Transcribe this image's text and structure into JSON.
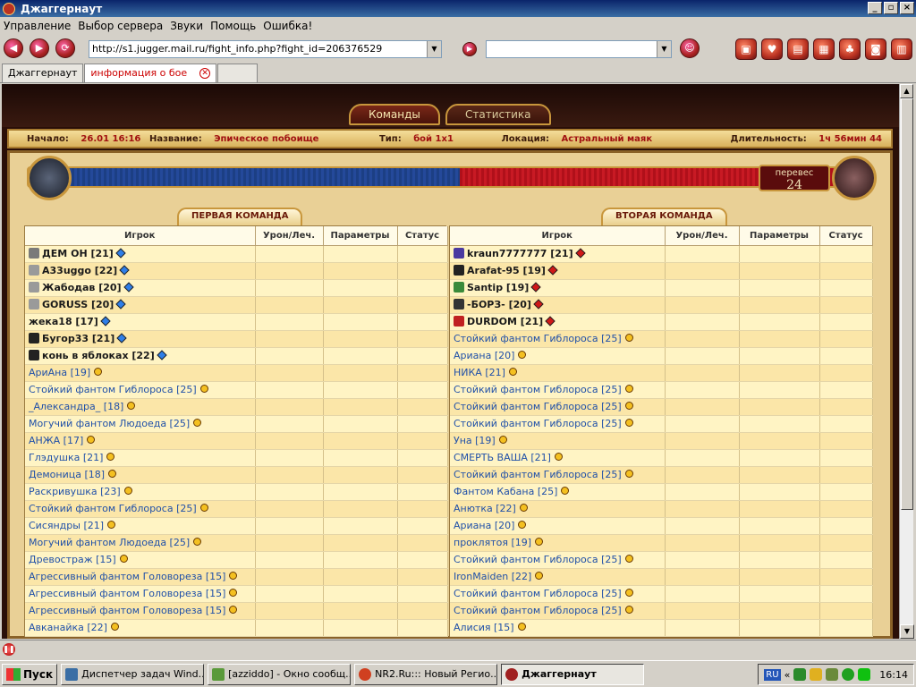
{
  "window": {
    "title": "Джаггернаут"
  },
  "menu": [
    "Управление",
    "Выбор сервера",
    "Звуки",
    "Помощь",
    "Ошибка!"
  ],
  "address": {
    "url": "http://s1.jugger.mail.ru/fight_info.php?fight_id=206376529"
  },
  "tabs": [
    {
      "label": "Джаггернаут"
    },
    {
      "label": "информация о бое"
    }
  ],
  "game_tabs": {
    "teams": "Команды",
    "stats": "Статистика"
  },
  "info": {
    "start_label": "Начало:",
    "start_value": "26.01 16:16",
    "name_label": "Название:",
    "name_value": "Эпическое побоище",
    "type_label": "Тип:",
    "type_value": "бой 1x1",
    "location_label": "Локация:",
    "location_value": "Астральный маяк",
    "duration_label": "Длительность:",
    "duration_value": "1ч 56мин 44"
  },
  "advantage": {
    "label": "перевес",
    "value": "24",
    "blue_fraction": 0.52
  },
  "team1": {
    "title": "ПЕРВАЯ КОМАНДА",
    "columns": [
      "Игрок",
      "Урон/Леч.",
      "Параметры",
      "Статус"
    ],
    "rows": [
      {
        "name": "ДЕМ ОН [21]",
        "kind": "p",
        "gem": "b",
        "icon": "#7a7a7a"
      },
      {
        "name": "A33uggo [22]",
        "kind": "p",
        "gem": "b",
        "icon": "#9a9a9a"
      },
      {
        "name": "Жабодав [20]",
        "kind": "p",
        "gem": "b",
        "icon": "#9a9a9a"
      },
      {
        "name": "GORUSS [20]",
        "kind": "p",
        "gem": "b",
        "icon": "#9a9a9a"
      },
      {
        "name": "жека18 [17]",
        "kind": "p",
        "gem": "b",
        "icon": ""
      },
      {
        "name": "Бугор33 [21]",
        "kind": "p",
        "gem": "b",
        "icon": "#222222"
      },
      {
        "name": "конь в яблоках [22]",
        "kind": "p",
        "gem": "b",
        "icon": "#222222"
      },
      {
        "name": "АриАна  [19]",
        "kind": "m",
        "gem": "y",
        "icon": ""
      },
      {
        "name": "Стойкий фантом Гиблороса [25]",
        "kind": "m",
        "gem": "y",
        "icon": ""
      },
      {
        "name": "_Александра_ [18]",
        "kind": "m",
        "gem": "y",
        "icon": ""
      },
      {
        "name": "Могучий фантом Людоеда [25]",
        "kind": "m",
        "gem": "y",
        "icon": ""
      },
      {
        "name": "АНЖА [17]",
        "kind": "m",
        "gem": "y",
        "icon": ""
      },
      {
        "name": "Глэдушка [21]",
        "kind": "m",
        "gem": "y",
        "icon": ""
      },
      {
        "name": "Демоница [18]",
        "kind": "m",
        "gem": "y",
        "icon": ""
      },
      {
        "name": "Раскривушка [23]",
        "kind": "m",
        "gem": "y",
        "icon": ""
      },
      {
        "name": "Стойкий фантом Гиблороса [25]",
        "kind": "m",
        "gem": "y",
        "icon": ""
      },
      {
        "name": "Сисяндры [21]",
        "kind": "m",
        "gem": "y",
        "icon": ""
      },
      {
        "name": "Могучий фантом Людоеда [25]",
        "kind": "m",
        "gem": "y",
        "icon": ""
      },
      {
        "name": "Древостраж [15]",
        "kind": "m",
        "gem": "y",
        "icon": ""
      },
      {
        "name": "Агрессивный фантом Головореза [15]",
        "kind": "m",
        "gem": "y",
        "icon": ""
      },
      {
        "name": "Агрессивный фантом Головореза [15]",
        "kind": "m",
        "gem": "y",
        "icon": ""
      },
      {
        "name": "Агрессивный фантом Головореза [15]",
        "kind": "m",
        "gem": "y",
        "icon": ""
      },
      {
        "name": "Авканайка [22]",
        "kind": "m",
        "gem": "y",
        "icon": ""
      }
    ]
  },
  "team2": {
    "title": "ВТОРАЯ КОМАНДА",
    "columns": [
      "Игрок",
      "Урон/Леч.",
      "Параметры",
      "Статус"
    ],
    "rows": [
      {
        "name": "kraun7777777 [21]",
        "kind": "p",
        "gem": "r",
        "icon": "#4a3aa0"
      },
      {
        "name": "Arafat-95 [19]",
        "kind": "p",
        "gem": "r",
        "icon": "#222222"
      },
      {
        "name": "Santip [19]",
        "kind": "p",
        "gem": "r",
        "icon": "#3a8a3a"
      },
      {
        "name": "-БОРЗ- [20]",
        "kind": "p",
        "gem": "r",
        "icon": "#333333"
      },
      {
        "name": "DURDOM [21]",
        "kind": "p",
        "gem": "r",
        "icon": "#c02020"
      },
      {
        "name": "Стойкий фантом Гиблороса [25]",
        "kind": "m",
        "gem": "y",
        "icon": ""
      },
      {
        "name": "Ариана [20]",
        "kind": "m",
        "gem": "y",
        "icon": ""
      },
      {
        "name": "НИКА [21]",
        "kind": "m",
        "gem": "y",
        "icon": ""
      },
      {
        "name": "Стойкий фантом Гиблороса [25]",
        "kind": "m",
        "gem": "y",
        "icon": ""
      },
      {
        "name": "Стойкий фантом Гиблороса [25]",
        "kind": "m",
        "gem": "y",
        "icon": ""
      },
      {
        "name": "Стойкий фантом Гиблороса [25]",
        "kind": "m",
        "gem": "y",
        "icon": ""
      },
      {
        "name": "Уна [19]",
        "kind": "m",
        "gem": "y",
        "icon": ""
      },
      {
        "name": "СМЕРТЬ ВАША [21]",
        "kind": "m",
        "gem": "y",
        "icon": ""
      },
      {
        "name": "Стойкий фантом Гиблороса [25]",
        "kind": "m",
        "gem": "y",
        "icon": ""
      },
      {
        "name": "Фантом Кабана [25]",
        "kind": "m",
        "gem": "y",
        "icon": ""
      },
      {
        "name": "Анютка [22]",
        "kind": "m",
        "gem": "y",
        "icon": ""
      },
      {
        "name": "Ариана [20]",
        "kind": "m",
        "gem": "y",
        "icon": ""
      },
      {
        "name": "проклятоя [19]",
        "kind": "m",
        "gem": "y",
        "icon": ""
      },
      {
        "name": "Стойкий фантом Гиблороса [25]",
        "kind": "m",
        "gem": "y",
        "icon": ""
      },
      {
        "name": "IronMaiden [22]",
        "kind": "m",
        "gem": "y",
        "icon": ""
      },
      {
        "name": "Стойкий фантом Гиблороса [25]",
        "kind": "m",
        "gem": "y",
        "icon": ""
      },
      {
        "name": "Стойкий фантом Гиблороса [25]",
        "kind": "m",
        "gem": "y",
        "icon": ""
      },
      {
        "name": "Алисия [15]",
        "kind": "m",
        "gem": "y",
        "icon": ""
      }
    ]
  },
  "taskbar": {
    "start": "Пуск",
    "items": [
      {
        "label": "Диспетчер задач Wind...",
        "color": "#3a6ea5"
      },
      {
        "label": "[azziddo] - Окно сообщ...",
        "color": "#5a9a3a"
      },
      {
        "label": "NR2.Ru::: Новый Регио...",
        "color": "#d04020"
      },
      {
        "label": "Джаггернаут",
        "color": "#a02020"
      }
    ],
    "lang": "RU",
    "clock": "16:14"
  }
}
